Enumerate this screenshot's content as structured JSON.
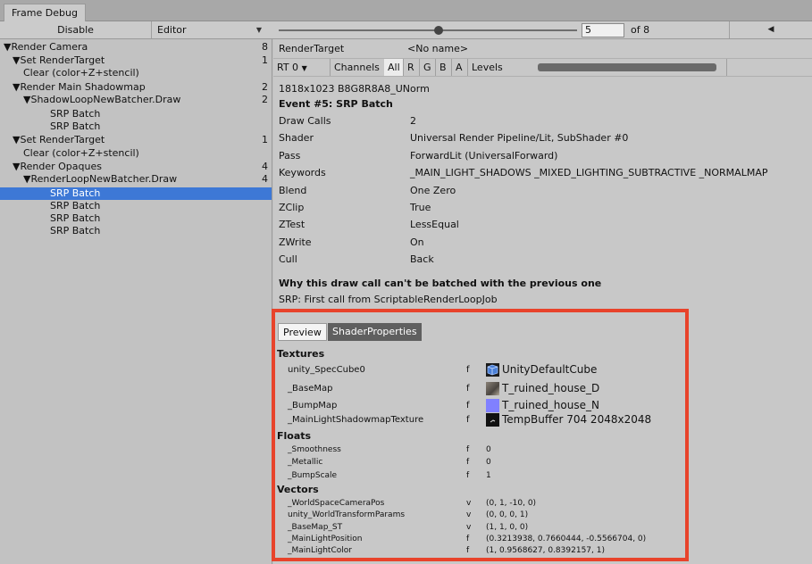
{
  "window": {
    "tab_title": "Frame Debug"
  },
  "toolbar": {
    "disable_label": "Disable",
    "editor_label": "Editor",
    "frame_value": "5",
    "frame_of": "of 8",
    "frame_progress": 0.625
  },
  "tree": [
    {
      "label": "▼Render Camera",
      "count": "8",
      "indent": 0,
      "selected": false
    },
    {
      "label": "▼Set RenderTarget",
      "count": "1",
      "indent": 1,
      "selected": false
    },
    {
      "label": "Clear (color+Z+stencil)",
      "count": "",
      "indent": 2,
      "selected": false
    },
    {
      "label": "▼Render Main Shadowmap",
      "count": "2",
      "indent": 1,
      "selected": false
    },
    {
      "label": "▼ShadowLoopNewBatcher.Draw",
      "count": "2",
      "indent": 2,
      "selected": false
    },
    {
      "label": "SRP Batch",
      "count": "",
      "indent": 3,
      "selected": false
    },
    {
      "label": "SRP Batch",
      "count": "",
      "indent": 3,
      "selected": false
    },
    {
      "label": "▼Set RenderTarget",
      "count": "1",
      "indent": 1,
      "selected": false
    },
    {
      "label": "Clear (color+Z+stencil)",
      "count": "",
      "indent": 2,
      "selected": false
    },
    {
      "label": "▼Render Opaques",
      "count": "4",
      "indent": 1,
      "selected": false
    },
    {
      "label": "▼RenderLoopNewBatcher.Draw",
      "count": "4",
      "indent": 2,
      "selected": false
    },
    {
      "label": "SRP Batch",
      "count": "",
      "indent": 3,
      "selected": true
    },
    {
      "label": "SRP Batch",
      "count": "",
      "indent": 3,
      "selected": false
    },
    {
      "label": "SRP Batch",
      "count": "",
      "indent": 3,
      "selected": false
    },
    {
      "label": "SRP Batch",
      "count": "",
      "indent": 3,
      "selected": false
    }
  ],
  "render_target": {
    "label": "RenderTarget",
    "value": "<No name>"
  },
  "options": {
    "rt": "RT 0",
    "channels": "Channels",
    "channel_all": "All",
    "channel_r": "R",
    "channel_g": "G",
    "channel_b": "B",
    "channel_a": "A",
    "levels": "Levels"
  },
  "info": {
    "format": "1818x1023 B8G8R8A8_UNorm",
    "event": "Event #5: SRP Batch",
    "rows": [
      {
        "label": "Draw Calls",
        "value": "2"
      },
      {
        "label": "Shader",
        "value": "Universal Render Pipeline/Lit, SubShader #0"
      },
      {
        "label": "Pass",
        "value": "ForwardLit (UniversalForward)"
      },
      {
        "label": "Keywords",
        "value": "_MAIN_LIGHT_SHADOWS _MIXED_LIGHTING_SUBTRACTIVE _NORMALMAP"
      },
      {
        "label": "Blend",
        "value": "One Zero"
      },
      {
        "label": "ZClip",
        "value": "True"
      },
      {
        "label": "ZTest",
        "value": "LessEqual"
      },
      {
        "label": "ZWrite",
        "value": "On"
      },
      {
        "label": "Cull",
        "value": "Back"
      }
    ],
    "batch_title": "Why this draw call can't be batched with the previous one",
    "batch_reason": "SRP: First call from ScriptableRenderLoopJob"
  },
  "preview_tabs": {
    "preview": "Preview",
    "shader_props": "ShaderProperties"
  },
  "textures": {
    "title": "Textures",
    "items": [
      {
        "name": "unity_SpecCube0",
        "type": "f",
        "value": "UnityDefaultCube",
        "thumb": "cube-icon"
      },
      {
        "name": "_BaseMap",
        "type": "f",
        "value": "T_ruined_house_D",
        "thumb": "texture-thumb-diffuse"
      },
      {
        "name": "_BumpMap",
        "type": "f",
        "value": "T_ruined_house_N",
        "thumb": "texture-thumb-normal"
      },
      {
        "name": "_MainLightShadowmapTexture",
        "type": "f",
        "value": "TempBuffer 704 2048x2048",
        "thumb": "texture-thumb-shadow"
      }
    ]
  },
  "floats": {
    "title": "Floats",
    "items": [
      {
        "name": "_Smoothness",
        "type": "f",
        "value": "0"
      },
      {
        "name": "_Metallic",
        "type": "f",
        "value": "0"
      },
      {
        "name": "_BumpScale",
        "type": "f",
        "value": "1"
      }
    ]
  },
  "vectors": {
    "title": "Vectors",
    "items": [
      {
        "name": "_WorldSpaceCameraPos",
        "type": "v",
        "value": "(0, 1, -10, 0)"
      },
      {
        "name": "unity_WorldTransformParams",
        "type": "v",
        "value": "(0, 0, 0, 1)"
      },
      {
        "name": "_BaseMap_ST",
        "type": "v",
        "value": "(1, 1, 0, 0)"
      },
      {
        "name": "_MainLightPosition",
        "type": "f",
        "value": "(0.3213938, 0.7660444, -0.5566704, 0)"
      },
      {
        "name": "_MainLightColor",
        "type": "f",
        "value": "(1, 0.9568627, 0.8392157, 1)"
      }
    ]
  },
  "colors": {
    "selection": "#3d78d6",
    "highlight_box": "#e8432b",
    "normal_map": "#8080ff"
  }
}
